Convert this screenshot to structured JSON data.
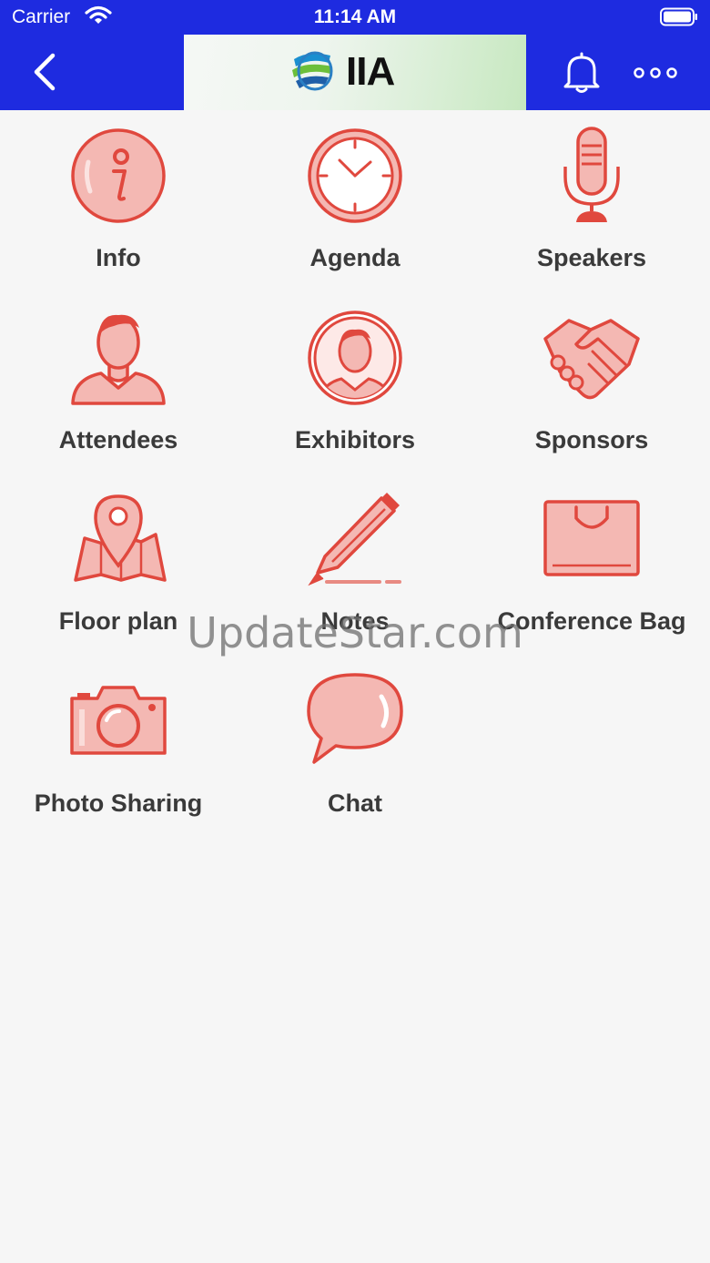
{
  "status_bar": {
    "carrier": "Carrier",
    "time": "11:14 AM"
  },
  "header": {
    "logo_text": "IIA"
  },
  "menu": [
    {
      "label": "Info",
      "icon": "info-icon"
    },
    {
      "label": "Agenda",
      "icon": "clock-icon"
    },
    {
      "label": "Speakers",
      "icon": "microphone-icon"
    },
    {
      "label": "Attendees",
      "icon": "person-icon"
    },
    {
      "label": "Exhibitors",
      "icon": "person-circle-icon"
    },
    {
      "label": "Sponsors",
      "icon": "handshake-icon"
    },
    {
      "label": "Floor plan",
      "icon": "map-pin-icon"
    },
    {
      "label": "Notes",
      "icon": "pen-icon"
    },
    {
      "label": "Conference Bag",
      "icon": "bag-icon"
    },
    {
      "label": "Photo Sharing",
      "icon": "camera-icon"
    },
    {
      "label": "Chat",
      "icon": "chat-bubble-icon"
    }
  ],
  "watermark": "UpdateStar.com",
  "colors": {
    "header": "#1e2be0",
    "icon_stroke": "#e0483e",
    "icon_fill": "#f4b8b3",
    "background": "#f6f6f6"
  }
}
